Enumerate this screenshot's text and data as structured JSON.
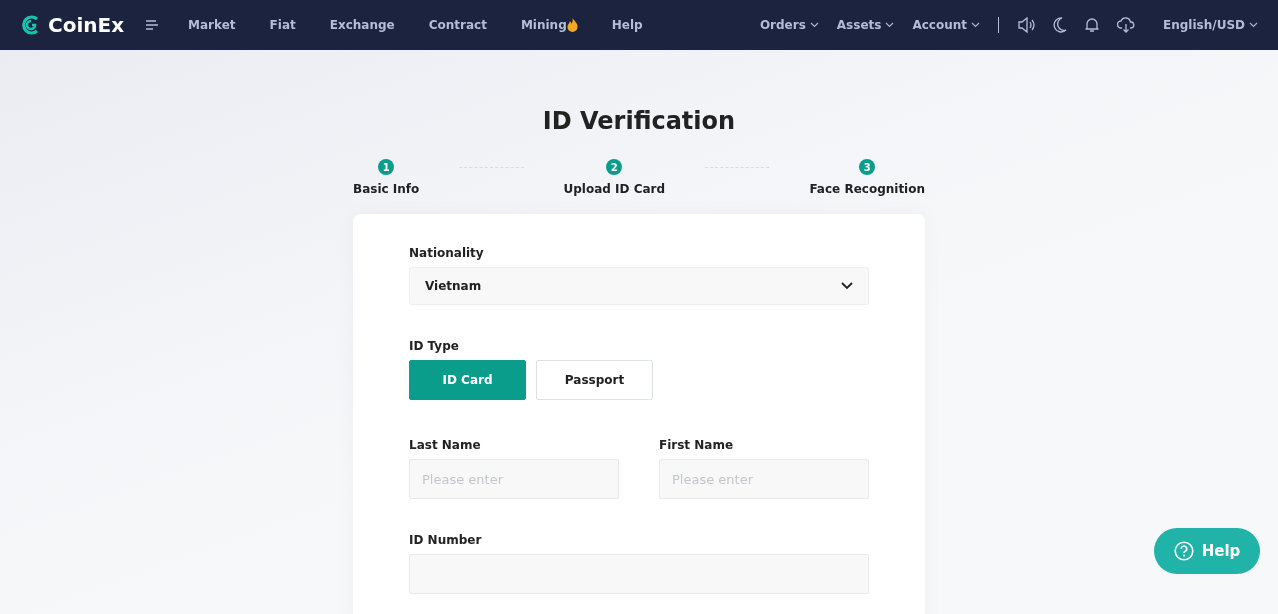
{
  "header": {
    "logo": "CoinEx",
    "nav": [
      {
        "label": "Market",
        "kind": "plain"
      },
      {
        "label": "Fiat",
        "kind": "plain"
      },
      {
        "label": "Exchange",
        "kind": "plain"
      },
      {
        "label": "Contract",
        "kind": "plain"
      },
      {
        "label": "Mining",
        "kind": "hot"
      },
      {
        "label": "Help",
        "kind": "plain"
      }
    ],
    "right_menus": [
      "Orders",
      "Assets",
      "Account"
    ],
    "language": "English/USD"
  },
  "title": "ID Verification",
  "steps": [
    {
      "number": "1",
      "label": "Basic Info"
    },
    {
      "number": "2",
      "label": "Upload ID Card"
    },
    {
      "number": "3",
      "label": "Face Recognition"
    }
  ],
  "form": {
    "nationality": {
      "label": "Nationality",
      "value": "Vietnam"
    },
    "id_type": {
      "label": "ID Type",
      "options": [
        {
          "label": "ID Card",
          "selected": true
        },
        {
          "label": "Passport",
          "selected": false
        }
      ]
    },
    "last_name": {
      "label": "Last Name",
      "placeholder": "Please enter"
    },
    "first_name": {
      "label": "First Name",
      "placeholder": "Please enter"
    },
    "id_number": {
      "label": "ID Number"
    }
  },
  "help_button": "Help"
}
